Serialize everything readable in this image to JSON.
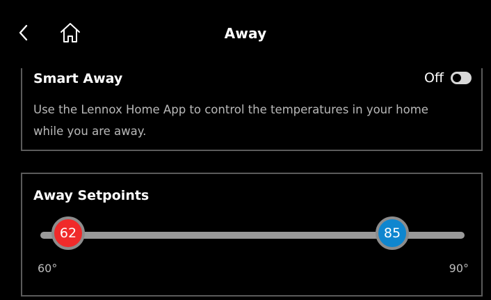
{
  "header": {
    "title": "Away",
    "back_icon": "chevron-left-icon",
    "home_icon": "home-icon"
  },
  "smart_away": {
    "label": "Smart Away",
    "toggle_state": "Off",
    "description": "Use the Lennox Home App to control the temperatures in your home while you are away."
  },
  "setpoints": {
    "label": "Away Setpoints",
    "heat_value": "62",
    "cool_value": "85",
    "min_label": "60°",
    "max_label": "90°",
    "heat_color": "#f02a2a",
    "cool_color": "#0f86cf"
  }
}
